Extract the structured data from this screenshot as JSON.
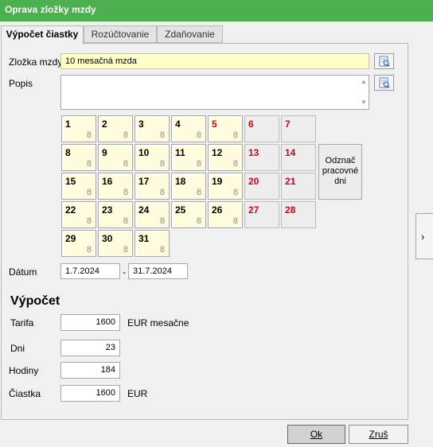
{
  "window": {
    "title": "Oprava zložky mzdy"
  },
  "tabs": [
    {
      "label": "Výpočet čiastky"
    },
    {
      "label": "Rozúčtovanie"
    },
    {
      "label": "Zdaňovanie"
    }
  ],
  "form": {
    "zlozka_label": "Zložka mzdy",
    "zlozka_value": "10  mesačná mzda",
    "popis_label": "Popis",
    "popis_value": "",
    "datum_label": "Dátum",
    "datum_from": "1.7.2024",
    "datum_separator": "-",
    "datum_to": "31.7.2024"
  },
  "calendar": {
    "days": [
      {
        "day": "1",
        "hours": "8",
        "weekend": false
      },
      {
        "day": "2",
        "hours": "8",
        "weekend": false
      },
      {
        "day": "3",
        "hours": "8",
        "weekend": false
      },
      {
        "day": "4",
        "hours": "8",
        "weekend": false
      },
      {
        "day": "5",
        "hours": "8",
        "weekend": false,
        "red": true
      },
      {
        "day": "6",
        "hours": "",
        "weekend": true
      },
      {
        "day": "7",
        "hours": "",
        "weekend": true
      },
      {
        "day": "8",
        "hours": "8",
        "weekend": false
      },
      {
        "day": "9",
        "hours": "8",
        "weekend": false
      },
      {
        "day": "10",
        "hours": "8",
        "weekend": false
      },
      {
        "day": "11",
        "hours": "8",
        "weekend": false
      },
      {
        "day": "12",
        "hours": "8",
        "weekend": false
      },
      {
        "day": "13",
        "hours": "",
        "weekend": true
      },
      {
        "day": "14",
        "hours": "",
        "weekend": true
      },
      {
        "day": "15",
        "hours": "8",
        "weekend": false
      },
      {
        "day": "16",
        "hours": "8",
        "weekend": false
      },
      {
        "day": "17",
        "hours": "8",
        "weekend": false
      },
      {
        "day": "18",
        "hours": "8",
        "weekend": false
      },
      {
        "day": "19",
        "hours": "8",
        "weekend": false
      },
      {
        "day": "20",
        "hours": "",
        "weekend": true
      },
      {
        "day": "21",
        "hours": "",
        "weekend": true
      },
      {
        "day": "22",
        "hours": "8",
        "weekend": false
      },
      {
        "day": "23",
        "hours": "8",
        "weekend": false
      },
      {
        "day": "24",
        "hours": "8",
        "weekend": false
      },
      {
        "day": "25",
        "hours": "8",
        "weekend": false
      },
      {
        "day": "26",
        "hours": "8",
        "weekend": false
      },
      {
        "day": "27",
        "hours": "",
        "weekend": true
      },
      {
        "day": "28",
        "hours": "",
        "weekend": true
      },
      {
        "day": "29",
        "hours": "8",
        "weekend": false
      },
      {
        "day": "30",
        "hours": "8",
        "weekend": false
      },
      {
        "day": "31",
        "hours": "8",
        "weekend": false
      }
    ],
    "mark_workdays_label": "Odznač pracovné dni"
  },
  "calc": {
    "title": "Výpočet",
    "tarifa_label": "Tarifa",
    "tarifa_value": "1600",
    "tarifa_unit": "EUR mesačne",
    "dni_label": "Dni",
    "dni_value": "23",
    "hodiny_label": "Hodiny",
    "hodiny_value": "184",
    "ciastka_label": "Čiastka",
    "ciastka_value": "1600",
    "ciastka_unit": "EUR"
  },
  "buttons": {
    "ok_label": "Ok",
    "cancel_label": "Zruš",
    "side_arrow": "›"
  },
  "colors": {
    "titlebar": "#4caf50",
    "weekend_text": "#d6001c",
    "workday_bg": "#fffbdc"
  },
  "icons": {
    "zlozka_lookup": "lookup-icon",
    "popis_lookup": "lookup-icon"
  }
}
